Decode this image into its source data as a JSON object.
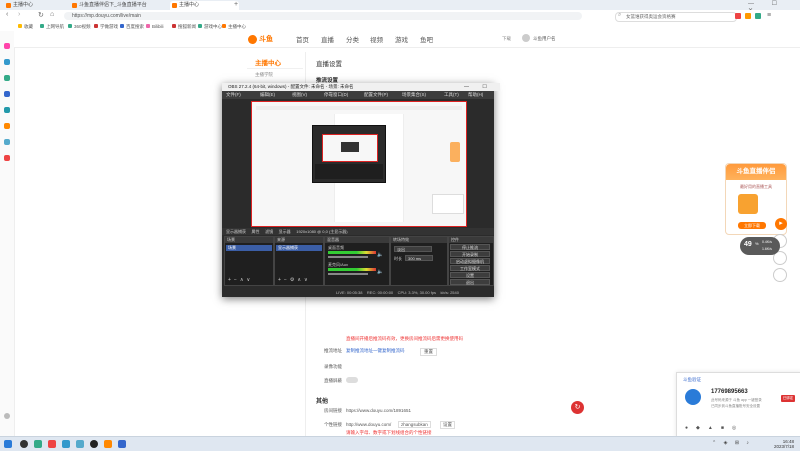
{
  "browser": {
    "tabs": [
      {
        "label": "主播中心",
        "active": false
      },
      {
        "label": "斗鱼直播伴侣下_斗鱼直播平台",
        "active": false
      },
      {
        "label": "主播中心",
        "active": true
      }
    ],
    "url": "https://mp.douyu.com/live/main",
    "search_placeholder": "女篮谁获得奥运会资格赛",
    "bookmarks": [
      "收藏",
      "上网导航",
      "360视频",
      "学做游戏",
      "百度搜索",
      "Bilibili",
      "搜狐新闻",
      "游戏中心",
      "主播中心"
    ]
  },
  "site": {
    "logo": "斗鱼",
    "nav": [
      "首页",
      "直播",
      "分类",
      "视频",
      "游戏",
      "鱼吧"
    ],
    "user_label": "下载",
    "username": "斗鱼用户名"
  },
  "sidebar": {
    "title": "主播中心",
    "sub": "主播学院"
  },
  "main": {
    "section_title": "直播设置",
    "subsection_title": "推流设置",
    "notice_red": "直播间开播后推流码有效，更换房间推流码后需更换使用码",
    "push_label": "推流地址",
    "push_links": "复制推流地址一键复制推流码",
    "push_btn": "重置",
    "record_label": "录像功能",
    "sensitive_label": "直播屏蔽",
    "other_title": "其他",
    "room_link_label": "房间链接",
    "room_link": "https://www.douyu.com/1891651",
    "custom_link_label": "个性链接",
    "custom_link_prefix": "http://www.douyu.com/",
    "custom_link_value": "zhangsubkan",
    "custom_link_btn": "设置",
    "custom_note": "请输入字母、数字或下划线组合的个性链接"
  },
  "obs": {
    "title": "OBS 27.2.4 (64-bit, windows) - 配置文件: 未命名 - 场景: 未命名",
    "menu": [
      "文件(F)",
      "编辑(E)",
      "视图(V)",
      "停靠窗口(D)",
      "配置文件(P)",
      "场景集合(S)",
      "工具(T)",
      "帮助(H)"
    ],
    "toolbar_text": "显示器捕获     属性     滤镜     显示器     1920x1080 @ 0,0 (主显示器)",
    "docks": [
      "场景",
      "来源",
      "混音器",
      "转场特效",
      "控件"
    ],
    "scene_item": "场景",
    "source_item": "显示器捕获",
    "mixer_tracks": [
      "桌面音频",
      "麦克风/Aux"
    ],
    "transition_type": "淡出",
    "duration_label": "时长",
    "duration_value": "300 ms",
    "controls": [
      "停止推流",
      "开始录制",
      "启动虚拟摄像机",
      "工作室模式",
      "设置",
      "退出"
    ],
    "status": "LIVE: 00:05:38    REC: 00:00:00    CPU: 3.3%, 30.00 fps    kb/s: 2540"
  },
  "promo": {
    "title": "斗鱼直播伴侣",
    "desc": "最好用的直播工具",
    "button": "立即下载"
  },
  "badge": {
    "value": "49",
    "unit": "%",
    "down": "0.4K/s",
    "up": "1.6K/s"
  },
  "phone_card": {
    "title": "斗鱼验证",
    "number": "17769895663",
    "line1": "此号码来源于 斗鱼 app 一键登录",
    "line2": "已同步到斗鱼直播账号安全设置",
    "button": "已绑定"
  },
  "taskbar": {
    "time": "16:48",
    "date": "2023/7/18"
  },
  "colors": {
    "brand": "#ff7700",
    "obs_bg": "#2b2b2b",
    "preview_border": "#dd2222"
  }
}
